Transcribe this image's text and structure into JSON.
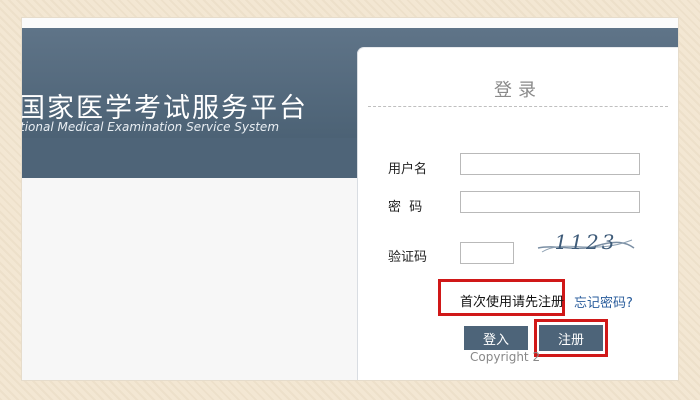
{
  "header": {
    "title_cn": "国家医学考试服务平台",
    "title_en": "tional Medical Examination Service System"
  },
  "login": {
    "title": "登录",
    "username_label": "用户名",
    "username_value": "",
    "password_label": "密  码",
    "password_value": "",
    "captcha_label": "验证码",
    "captcha_value": "",
    "captcha_image_text": "1123",
    "first_use_link": "首次使用请先注册",
    "forgot_password_link": "忘记密码?",
    "login_button": "登入",
    "register_button": "注册",
    "copyright": "Copyright 2 "
  },
  "colors": {
    "banner": "#4e6478",
    "button": "#4d6479",
    "highlight": "#d01818",
    "link_blue": "#2a5d9c"
  }
}
